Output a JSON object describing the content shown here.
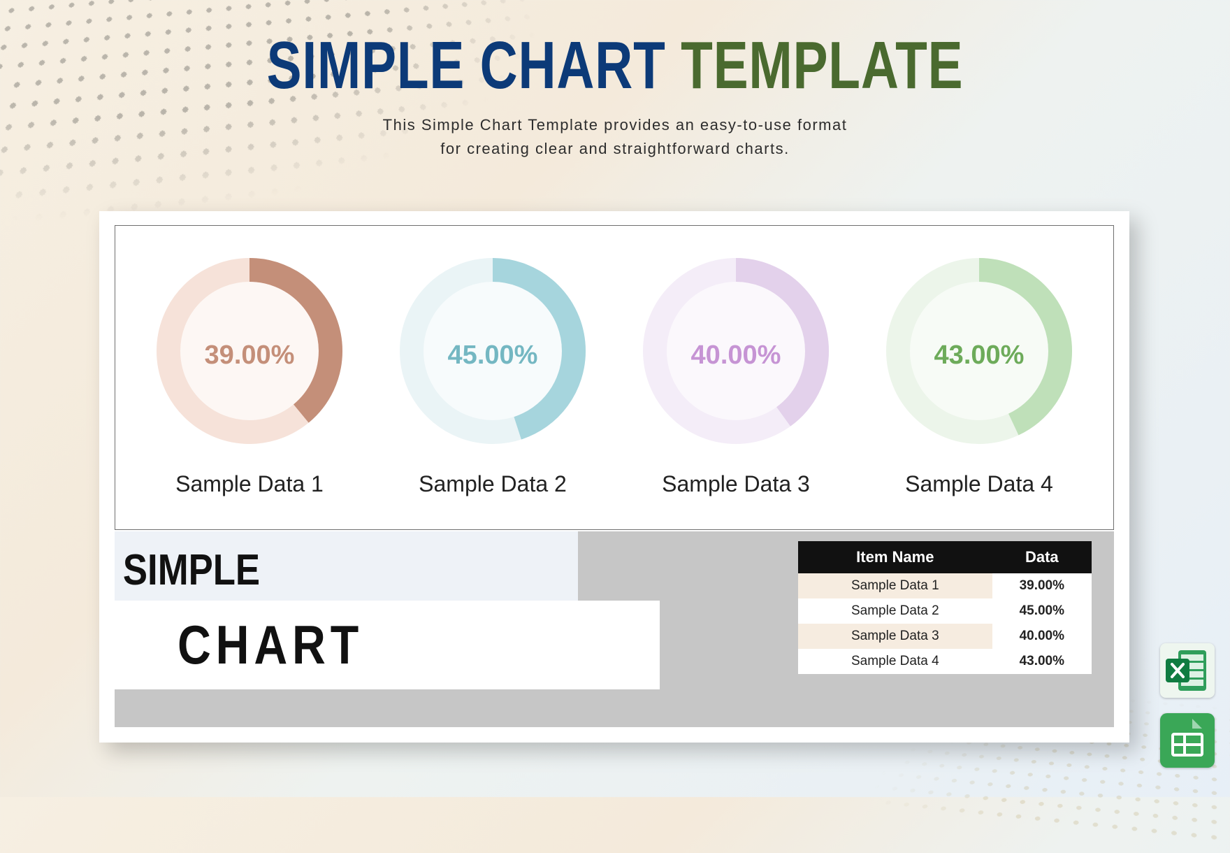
{
  "title": {
    "part1": "SIMPLE CHART",
    "part2": "TEMPLATE"
  },
  "subtitle_line1": "This Simple Chart Template provides an easy-to-use format",
  "subtitle_line2": "for creating clear and straightforward charts.",
  "gauges": [
    {
      "label": "Sample Data 1",
      "value": 39.0,
      "value_text": "39.00%",
      "color": "#c48f79",
      "text_color": "#c48f79"
    },
    {
      "label": "Sample Data 2",
      "value": 45.0,
      "value_text": "45.00%",
      "color": "#a6d5dd",
      "text_color": "#74b7c2"
    },
    {
      "label": "Sample Data 3",
      "value": 40.0,
      "value_text": "40.00%",
      "color": "#e3d1eb",
      "text_color": "#c694d4"
    },
    {
      "label": "Sample Data 4",
      "value": 43.0,
      "value_text": "43.00%",
      "color": "#bfe0b9",
      "text_color": "#6dab5a"
    }
  ],
  "label_block": {
    "line1": "SIMPLE",
    "line2": "CHART"
  },
  "data_table": {
    "headers": [
      "Item Name",
      "Data"
    ],
    "rows": [
      {
        "name": "Sample Data 1",
        "data": "39.00%"
      },
      {
        "name": "Sample Data 2",
        "data": "45.00%"
      },
      {
        "name": "Sample Data 3",
        "data": "40.00%"
      },
      {
        "name": "Sample Data 4",
        "data": "43.00%"
      }
    ]
  },
  "colors": {
    "title_blue": "#0c3a78",
    "title_green": "#4a6a2f",
    "bg_warm": "#f4eadb",
    "bg_cool": "#e7eff7"
  },
  "chart_data": {
    "type": "pie",
    "note": "Four radial progress gauges, each showing a single percentage value (filled vs remaining).",
    "series": [
      {
        "name": "Sample Data 1",
        "values": [
          39.0,
          61.0
        ],
        "categories": [
          "value",
          "remaining"
        ]
      },
      {
        "name": "Sample Data 2",
        "values": [
          45.0,
          55.0
        ],
        "categories": [
          "value",
          "remaining"
        ]
      },
      {
        "name": "Sample Data 3",
        "values": [
          40.0,
          60.0
        ],
        "categories": [
          "value",
          "remaining"
        ]
      },
      {
        "name": "Sample Data 4",
        "values": [
          43.0,
          57.0
        ],
        "categories": [
          "value",
          "remaining"
        ]
      }
    ],
    "title": "Simple Chart Template",
    "ylim": [
      0,
      100
    ]
  }
}
